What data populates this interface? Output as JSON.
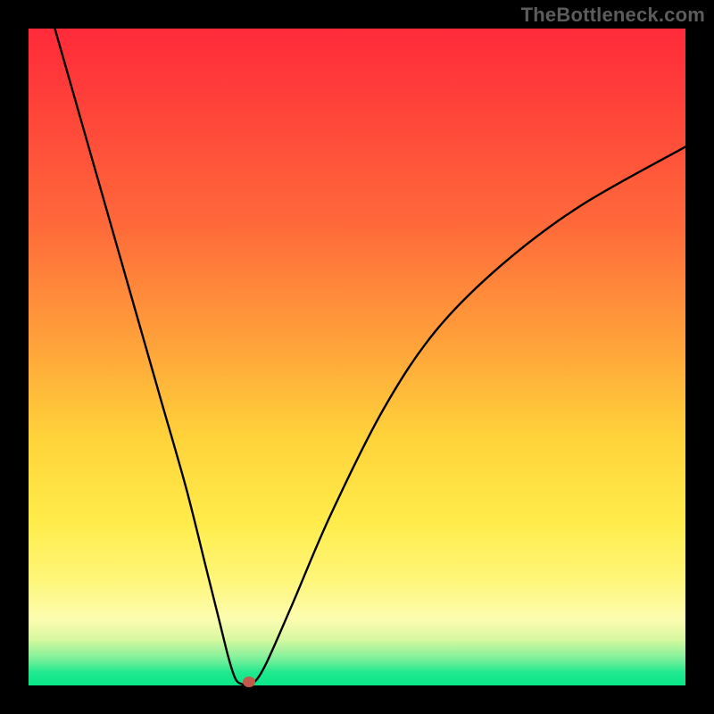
{
  "watermark": "TheBottleneck.com",
  "colors": {
    "frame": "#000000",
    "curve": "#000000",
    "marker": "#c15a4a",
    "gradient_top": "#ff2a3a",
    "gradient_bottom": "#08e788"
  },
  "chart_data": {
    "type": "line",
    "title": "",
    "xlabel": "",
    "ylabel": "",
    "xlim": [
      0,
      100
    ],
    "ylim": [
      0,
      100
    ],
    "grid": false,
    "legend": false,
    "series": [
      {
        "name": "curve",
        "x": [
          4,
          8,
          12,
          16,
          20,
          24,
          27,
          29,
          30.5,
          31.5,
          32.5,
          34,
          36,
          40,
          46,
          54,
          62,
          72,
          84,
          100
        ],
        "y": [
          100,
          86,
          72,
          58,
          44,
          30,
          18,
          10,
          4,
          1,
          0.2,
          0.2,
          3,
          12,
          26,
          42,
          54,
          64,
          73,
          82
        ]
      }
    ],
    "marker": {
      "x": 33.5,
      "y": 0.5,
      "label": "",
      "color": "#c15a4a"
    },
    "notes": "Background is a vertical red→green gradient; curve is a black V-shaped bottleneck curve reaching its minimum near x≈33 at the green band."
  }
}
